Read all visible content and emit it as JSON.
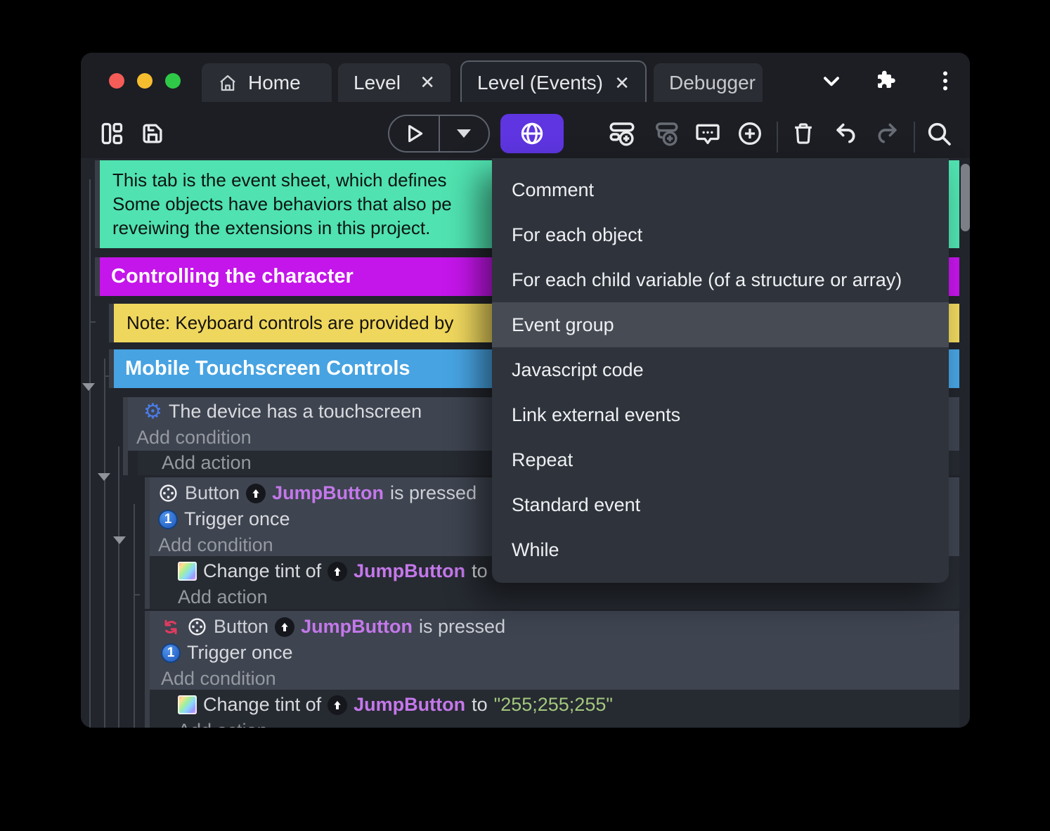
{
  "colors": {
    "accent_purple": "#5e35e0",
    "comment_teal": "#50e2b0",
    "group_magenta": "#c415ea",
    "note_yellow": "#efd75e",
    "group_blue": "#47a3e2",
    "object_purple": "#c478ea",
    "string_green": "#a3c97e",
    "menu_highlight": "#474b54",
    "traffic_red": "#f45c57",
    "traffic_yellow": "#f6bd2e",
    "traffic_green": "#2fc948"
  },
  "titlebar": {
    "tabs": [
      {
        "label": "Home"
      },
      {
        "label": "Level",
        "close": "✕"
      },
      {
        "label": "Level (Events)",
        "close": "✕"
      },
      {
        "label": "Debugger"
      }
    ]
  },
  "menu": {
    "highlighted": "Event group",
    "items": [
      "Comment",
      "For each object",
      "For each child variable (of a structure or array)",
      "Event group",
      "Javascript code",
      "Link external events",
      "Repeat",
      "Standard event",
      "While"
    ]
  },
  "sheet": {
    "comment_lines": [
      "This tab is the event sheet, which defines",
      "Some objects have behaviors that also pe",
      "reveiwing the extensions in this project."
    ],
    "group1": "Controlling the character",
    "note": "Note: Keyboard controls are provided by",
    "group2": "Mobile Touchscreen Controls",
    "add_condition": "Add condition",
    "add_action": "Add action",
    "objects": {
      "jump_button": "JumpButton"
    },
    "events": {
      "touchscreen": {
        "condition": "The device has a touchscreen"
      },
      "jump1": {
        "cond_pre": "Button",
        "cond_post": "is pressed",
        "trigger": "Trigger once",
        "act_pre": "Change tint of",
        "act_post": "to"
      },
      "jump2": {
        "cond_pre": "Button",
        "cond_post": "is pressed",
        "trigger": "Trigger once",
        "act_pre": "Change tint of",
        "act_post": "to",
        "act_value": "\"255;255;255\""
      }
    }
  }
}
